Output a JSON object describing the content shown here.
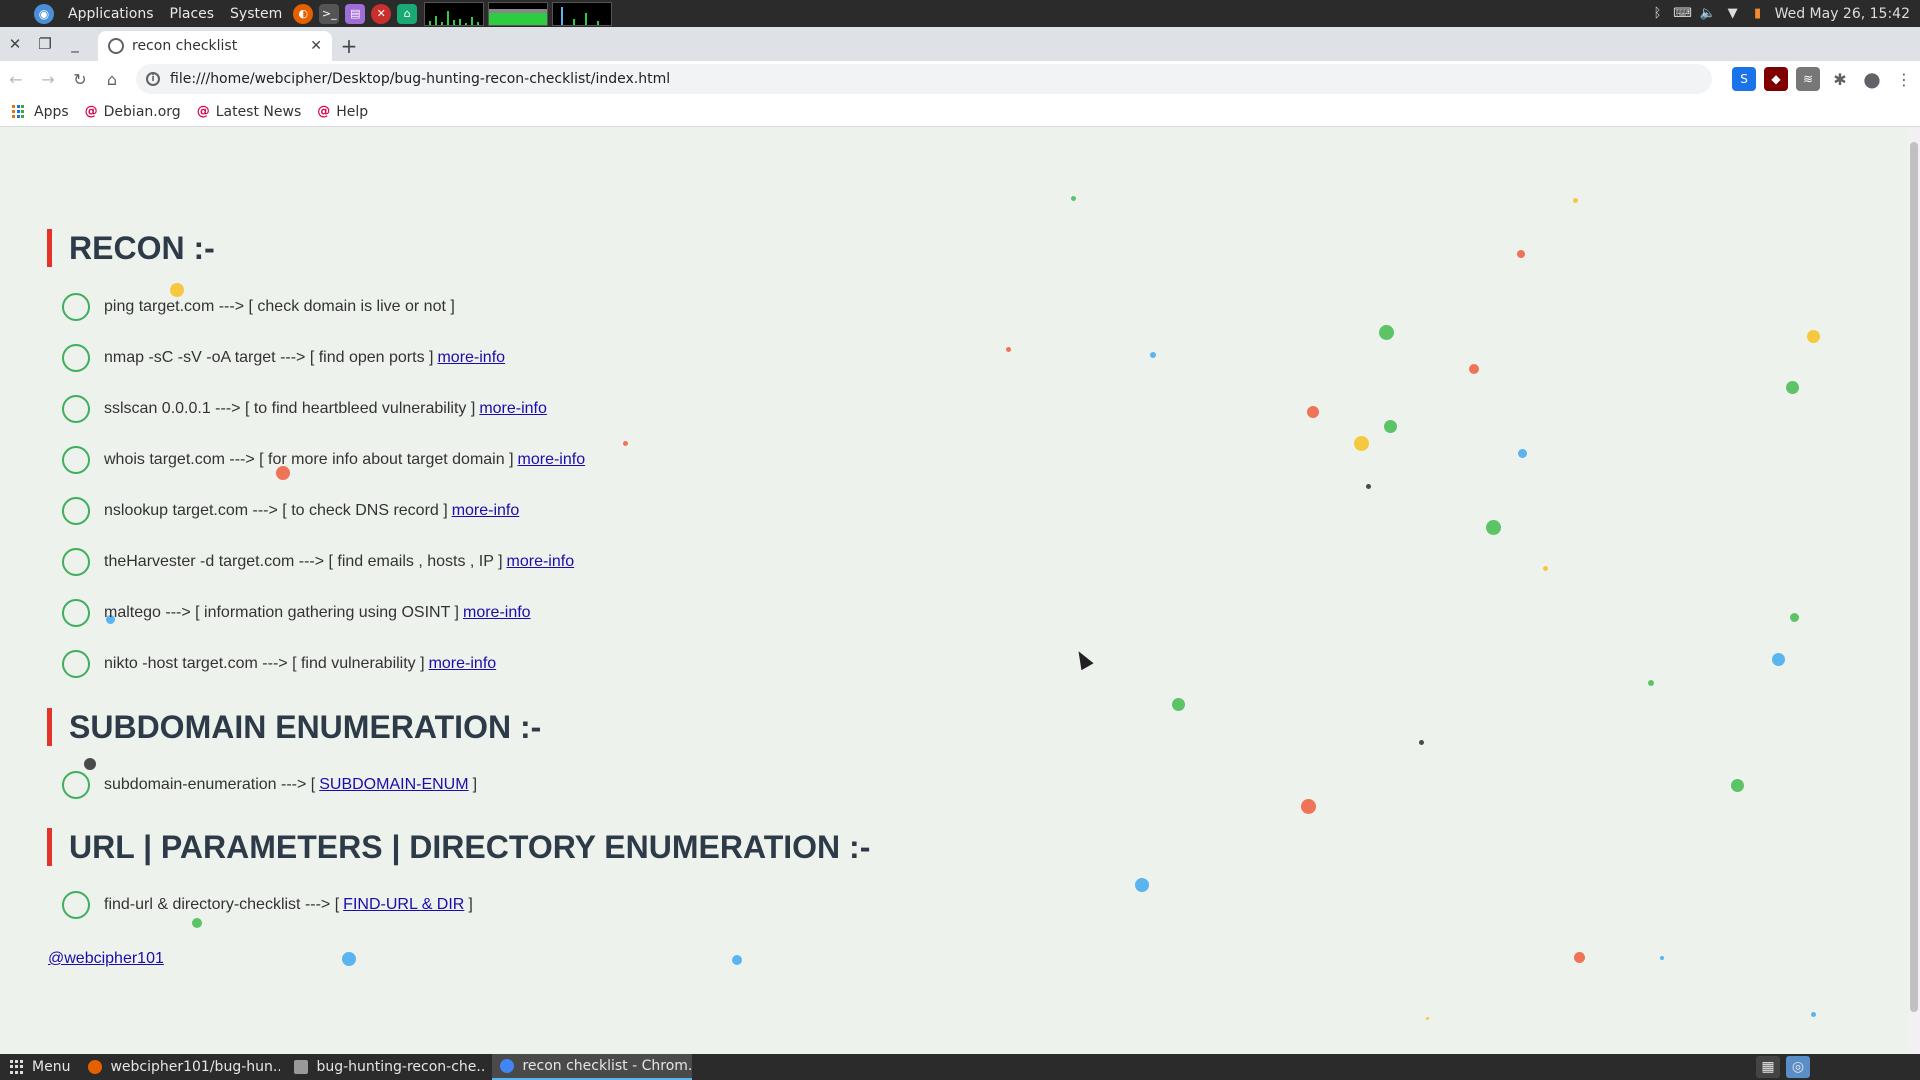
{
  "system_panel": {
    "menus": [
      "Applications",
      "Places",
      "System"
    ],
    "clock": "Wed May 26, 15:42"
  },
  "browser": {
    "tab_title": "recon checklist",
    "url": "file:///home/webcipher/Desktop/bug-hunting-recon-checklist/index.html",
    "bookmarks": [
      "Apps",
      "Debian.org",
      "Latest News",
      "Help"
    ]
  },
  "page": {
    "sections": [
      {
        "title": "RECON :-",
        "items": [
          {
            "text": "ping target.com ---> [ check domain is live or not ]",
            "link": ""
          },
          {
            "text": "nmap -sC -sV -oA target ---> [ find open ports ]",
            "link": "more-info"
          },
          {
            "text": "sslscan 0.0.0.1 ---> [ to find heartbleed vulnerability ]",
            "link": "more-info"
          },
          {
            "text": "whois target.com ---> [ for more info about target domain ]",
            "link": "more-info"
          },
          {
            "text": "nslookup target.com ---> [ to check DNS record ]",
            "link": "more-info"
          },
          {
            "text": "theHarvester -d target.com ---> [ find emails , hosts , IP ]",
            "link": "more-info"
          },
          {
            "text": "maltego ---> [ information gathering using OSINT ]",
            "link": "more-info"
          },
          {
            "text": "nikto -host target.com ---> [ find vulnerability ]",
            "link": "more-info"
          }
        ]
      },
      {
        "title": "SUBDOMAIN ENUMERATION :-",
        "items": [
          {
            "text": "subdomain-enumeration ---> [",
            "link": "SUBDOMAIN-ENUM",
            "suffix": "]"
          }
        ]
      },
      {
        "title": "URL | PARAMETERS | DIRECTORY ENUMERATION :-",
        "items": [
          {
            "text": "find-url & directory-checklist ---> [",
            "link": "FIND-URL & DIR",
            "suffix": "]"
          }
        ]
      }
    ],
    "footer_link": "@webcipher101"
  },
  "taskbar": {
    "menu_label": "Menu",
    "items": [
      {
        "label": "webcipher101/bug-hun...",
        "icon": "firefox-icon"
      },
      {
        "label": "bug-hunting-recon-che...",
        "icon": "folder-icon"
      },
      {
        "label": "recon checklist - Chrom...",
        "icon": "chrome-icon"
      }
    ]
  }
}
